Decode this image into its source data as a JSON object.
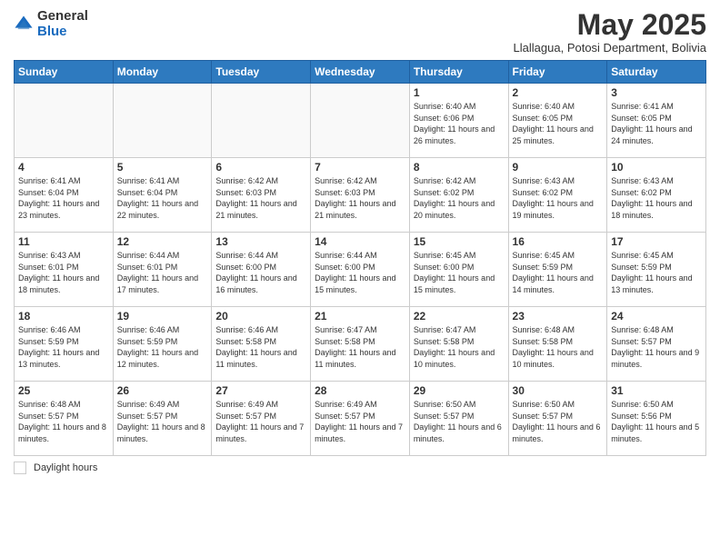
{
  "logo": {
    "general": "General",
    "blue": "Blue"
  },
  "title": "May 2025",
  "subtitle": "Llallagua, Potosi Department, Bolivia",
  "days_of_week": [
    "Sunday",
    "Monday",
    "Tuesday",
    "Wednesday",
    "Thursday",
    "Friday",
    "Saturday"
  ],
  "weeks": [
    [
      {
        "day": "",
        "info": ""
      },
      {
        "day": "",
        "info": ""
      },
      {
        "day": "",
        "info": ""
      },
      {
        "day": "",
        "info": ""
      },
      {
        "day": "1",
        "info": "Sunrise: 6:40 AM\nSunset: 6:06 PM\nDaylight: 11 hours and 26 minutes."
      },
      {
        "day": "2",
        "info": "Sunrise: 6:40 AM\nSunset: 6:05 PM\nDaylight: 11 hours and 25 minutes."
      },
      {
        "day": "3",
        "info": "Sunrise: 6:41 AM\nSunset: 6:05 PM\nDaylight: 11 hours and 24 minutes."
      }
    ],
    [
      {
        "day": "4",
        "info": "Sunrise: 6:41 AM\nSunset: 6:04 PM\nDaylight: 11 hours and 23 minutes."
      },
      {
        "day": "5",
        "info": "Sunrise: 6:41 AM\nSunset: 6:04 PM\nDaylight: 11 hours and 22 minutes."
      },
      {
        "day": "6",
        "info": "Sunrise: 6:42 AM\nSunset: 6:03 PM\nDaylight: 11 hours and 21 minutes."
      },
      {
        "day": "7",
        "info": "Sunrise: 6:42 AM\nSunset: 6:03 PM\nDaylight: 11 hours and 21 minutes."
      },
      {
        "day": "8",
        "info": "Sunrise: 6:42 AM\nSunset: 6:02 PM\nDaylight: 11 hours and 20 minutes."
      },
      {
        "day": "9",
        "info": "Sunrise: 6:43 AM\nSunset: 6:02 PM\nDaylight: 11 hours and 19 minutes."
      },
      {
        "day": "10",
        "info": "Sunrise: 6:43 AM\nSunset: 6:02 PM\nDaylight: 11 hours and 18 minutes."
      }
    ],
    [
      {
        "day": "11",
        "info": "Sunrise: 6:43 AM\nSunset: 6:01 PM\nDaylight: 11 hours and 18 minutes."
      },
      {
        "day": "12",
        "info": "Sunrise: 6:44 AM\nSunset: 6:01 PM\nDaylight: 11 hours and 17 minutes."
      },
      {
        "day": "13",
        "info": "Sunrise: 6:44 AM\nSunset: 6:00 PM\nDaylight: 11 hours and 16 minutes."
      },
      {
        "day": "14",
        "info": "Sunrise: 6:44 AM\nSunset: 6:00 PM\nDaylight: 11 hours and 15 minutes."
      },
      {
        "day": "15",
        "info": "Sunrise: 6:45 AM\nSunset: 6:00 PM\nDaylight: 11 hours and 15 minutes."
      },
      {
        "day": "16",
        "info": "Sunrise: 6:45 AM\nSunset: 5:59 PM\nDaylight: 11 hours and 14 minutes."
      },
      {
        "day": "17",
        "info": "Sunrise: 6:45 AM\nSunset: 5:59 PM\nDaylight: 11 hours and 13 minutes."
      }
    ],
    [
      {
        "day": "18",
        "info": "Sunrise: 6:46 AM\nSunset: 5:59 PM\nDaylight: 11 hours and 13 minutes."
      },
      {
        "day": "19",
        "info": "Sunrise: 6:46 AM\nSunset: 5:59 PM\nDaylight: 11 hours and 12 minutes."
      },
      {
        "day": "20",
        "info": "Sunrise: 6:46 AM\nSunset: 5:58 PM\nDaylight: 11 hours and 11 minutes."
      },
      {
        "day": "21",
        "info": "Sunrise: 6:47 AM\nSunset: 5:58 PM\nDaylight: 11 hours and 11 minutes."
      },
      {
        "day": "22",
        "info": "Sunrise: 6:47 AM\nSunset: 5:58 PM\nDaylight: 11 hours and 10 minutes."
      },
      {
        "day": "23",
        "info": "Sunrise: 6:48 AM\nSunset: 5:58 PM\nDaylight: 11 hours and 10 minutes."
      },
      {
        "day": "24",
        "info": "Sunrise: 6:48 AM\nSunset: 5:57 PM\nDaylight: 11 hours and 9 minutes."
      }
    ],
    [
      {
        "day": "25",
        "info": "Sunrise: 6:48 AM\nSunset: 5:57 PM\nDaylight: 11 hours and 8 minutes."
      },
      {
        "day": "26",
        "info": "Sunrise: 6:49 AM\nSunset: 5:57 PM\nDaylight: 11 hours and 8 minutes."
      },
      {
        "day": "27",
        "info": "Sunrise: 6:49 AM\nSunset: 5:57 PM\nDaylight: 11 hours and 7 minutes."
      },
      {
        "day": "28",
        "info": "Sunrise: 6:49 AM\nSunset: 5:57 PM\nDaylight: 11 hours and 7 minutes."
      },
      {
        "day": "29",
        "info": "Sunrise: 6:50 AM\nSunset: 5:57 PM\nDaylight: 11 hours and 6 minutes."
      },
      {
        "day": "30",
        "info": "Sunrise: 6:50 AM\nSunset: 5:57 PM\nDaylight: 11 hours and 6 minutes."
      },
      {
        "day": "31",
        "info": "Sunrise: 6:50 AM\nSunset: 5:56 PM\nDaylight: 11 hours and 5 minutes."
      }
    ]
  ],
  "footer": {
    "daylight_label": "Daylight hours"
  }
}
